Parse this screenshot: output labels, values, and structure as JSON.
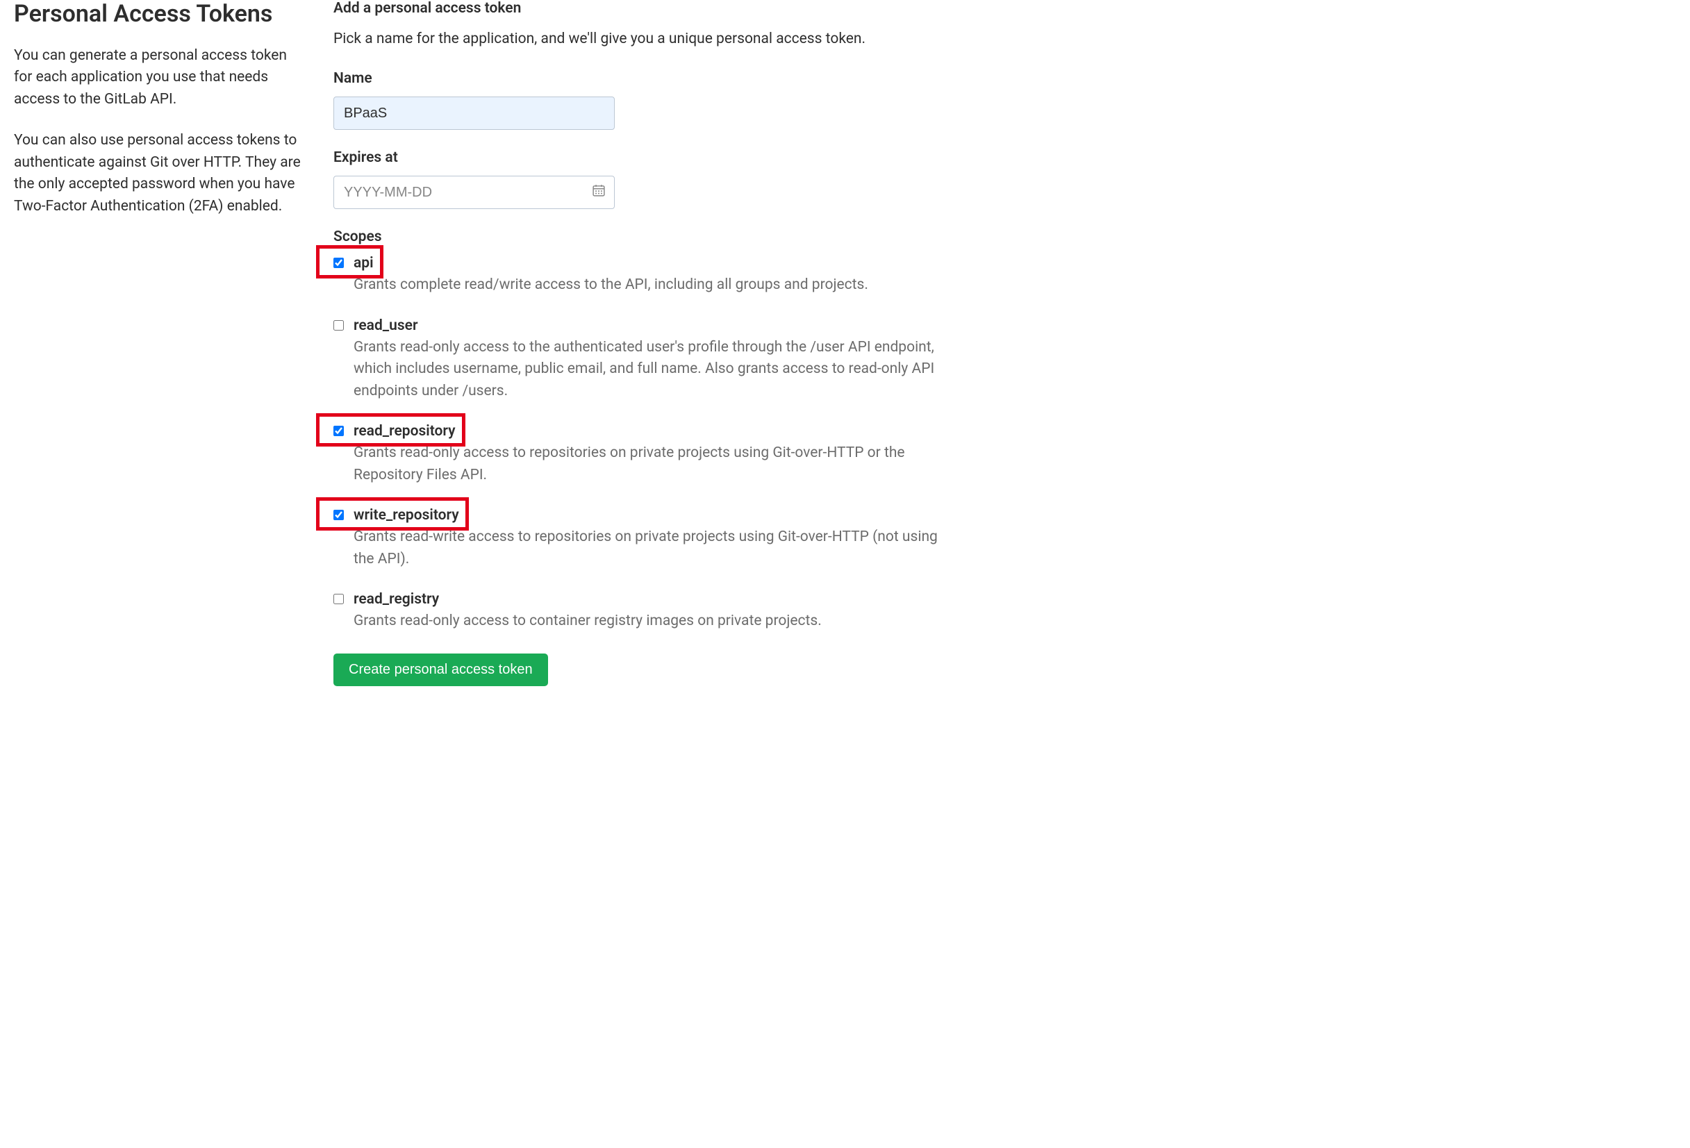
{
  "sidebar": {
    "title": "Personal Access Tokens",
    "desc1": "You can generate a personal access token for each application you use that needs access to the GitLab API.",
    "desc2": "You can also use personal access tokens to authenticate against Git over HTTP. They are the only accepted password when you have Two-Factor Authentication (2FA) enabled."
  },
  "form": {
    "heading": "Add a personal access token",
    "intro": "Pick a name for the application, and we'll give you a unique personal access token.",
    "name_label": "Name",
    "name_value": "BPaaS",
    "expires_label": "Expires at",
    "expires_placeholder": "YYYY-MM-DD",
    "scopes_label": "Scopes",
    "submit_label": "Create personal access token"
  },
  "scopes": [
    {
      "name": "api",
      "desc": "Grants complete read/write access to the API, including all groups and projects.",
      "checked": true,
      "highlighted": true
    },
    {
      "name": "read_user",
      "desc": "Grants read-only access to the authenticated user's profile through the /user API endpoint, which includes username, public email, and full name. Also grants access to read-only API endpoints under /users.",
      "checked": false,
      "highlighted": false
    },
    {
      "name": "read_repository",
      "desc": "Grants read-only access to repositories on private projects using Git-over-HTTP or the Repository Files API.",
      "checked": true,
      "highlighted": true
    },
    {
      "name": "write_repository",
      "desc": "Grants read-write access to repositories on private projects using Git-over-HTTP (not using the API).",
      "checked": true,
      "highlighted": true
    },
    {
      "name": "read_registry",
      "desc": "Grants read-only access to container registry images on private projects.",
      "checked": false,
      "highlighted": false
    }
  ]
}
